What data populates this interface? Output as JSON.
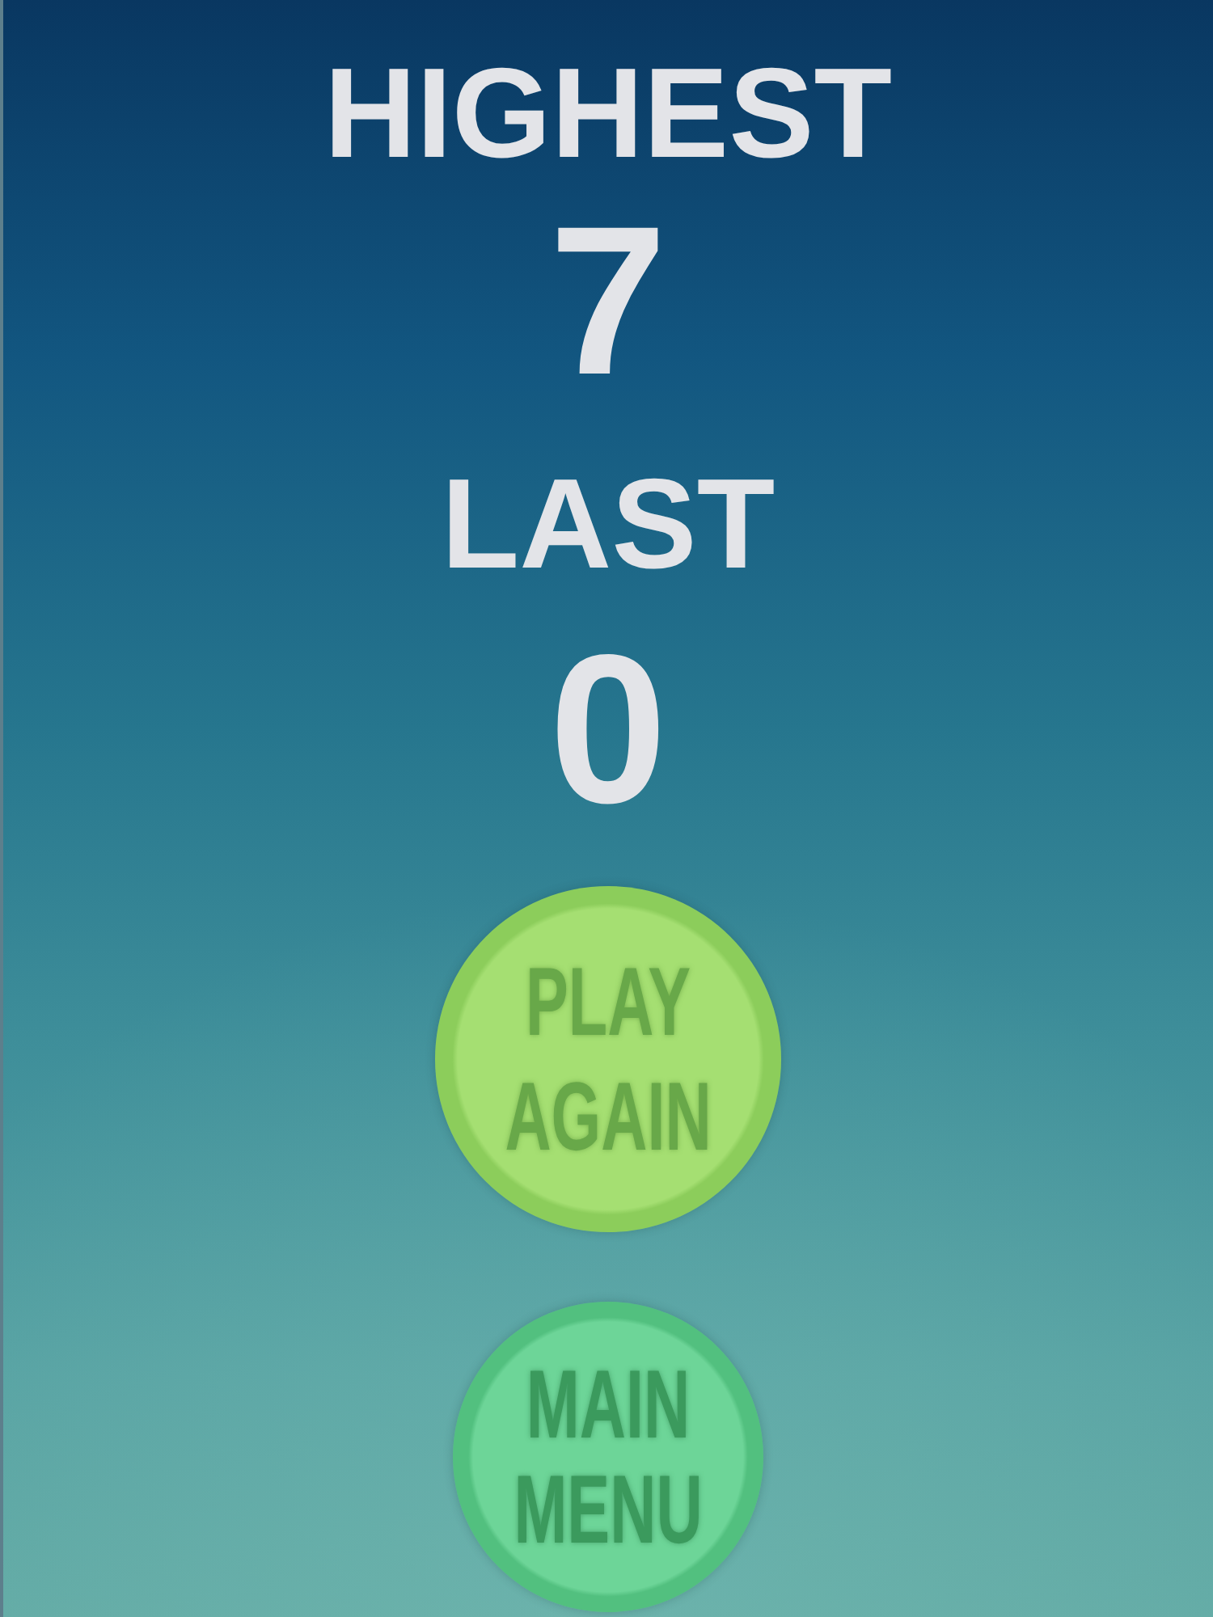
{
  "scores": [
    {
      "label": "HIGHEST",
      "value": "7"
    },
    {
      "label": "LAST",
      "value": "0"
    }
  ],
  "buttons": [
    {
      "kind": "play",
      "label": "PLAY AGAIN"
    },
    {
      "kind": "menu",
      "label": "MAIN MENU"
    }
  ]
}
